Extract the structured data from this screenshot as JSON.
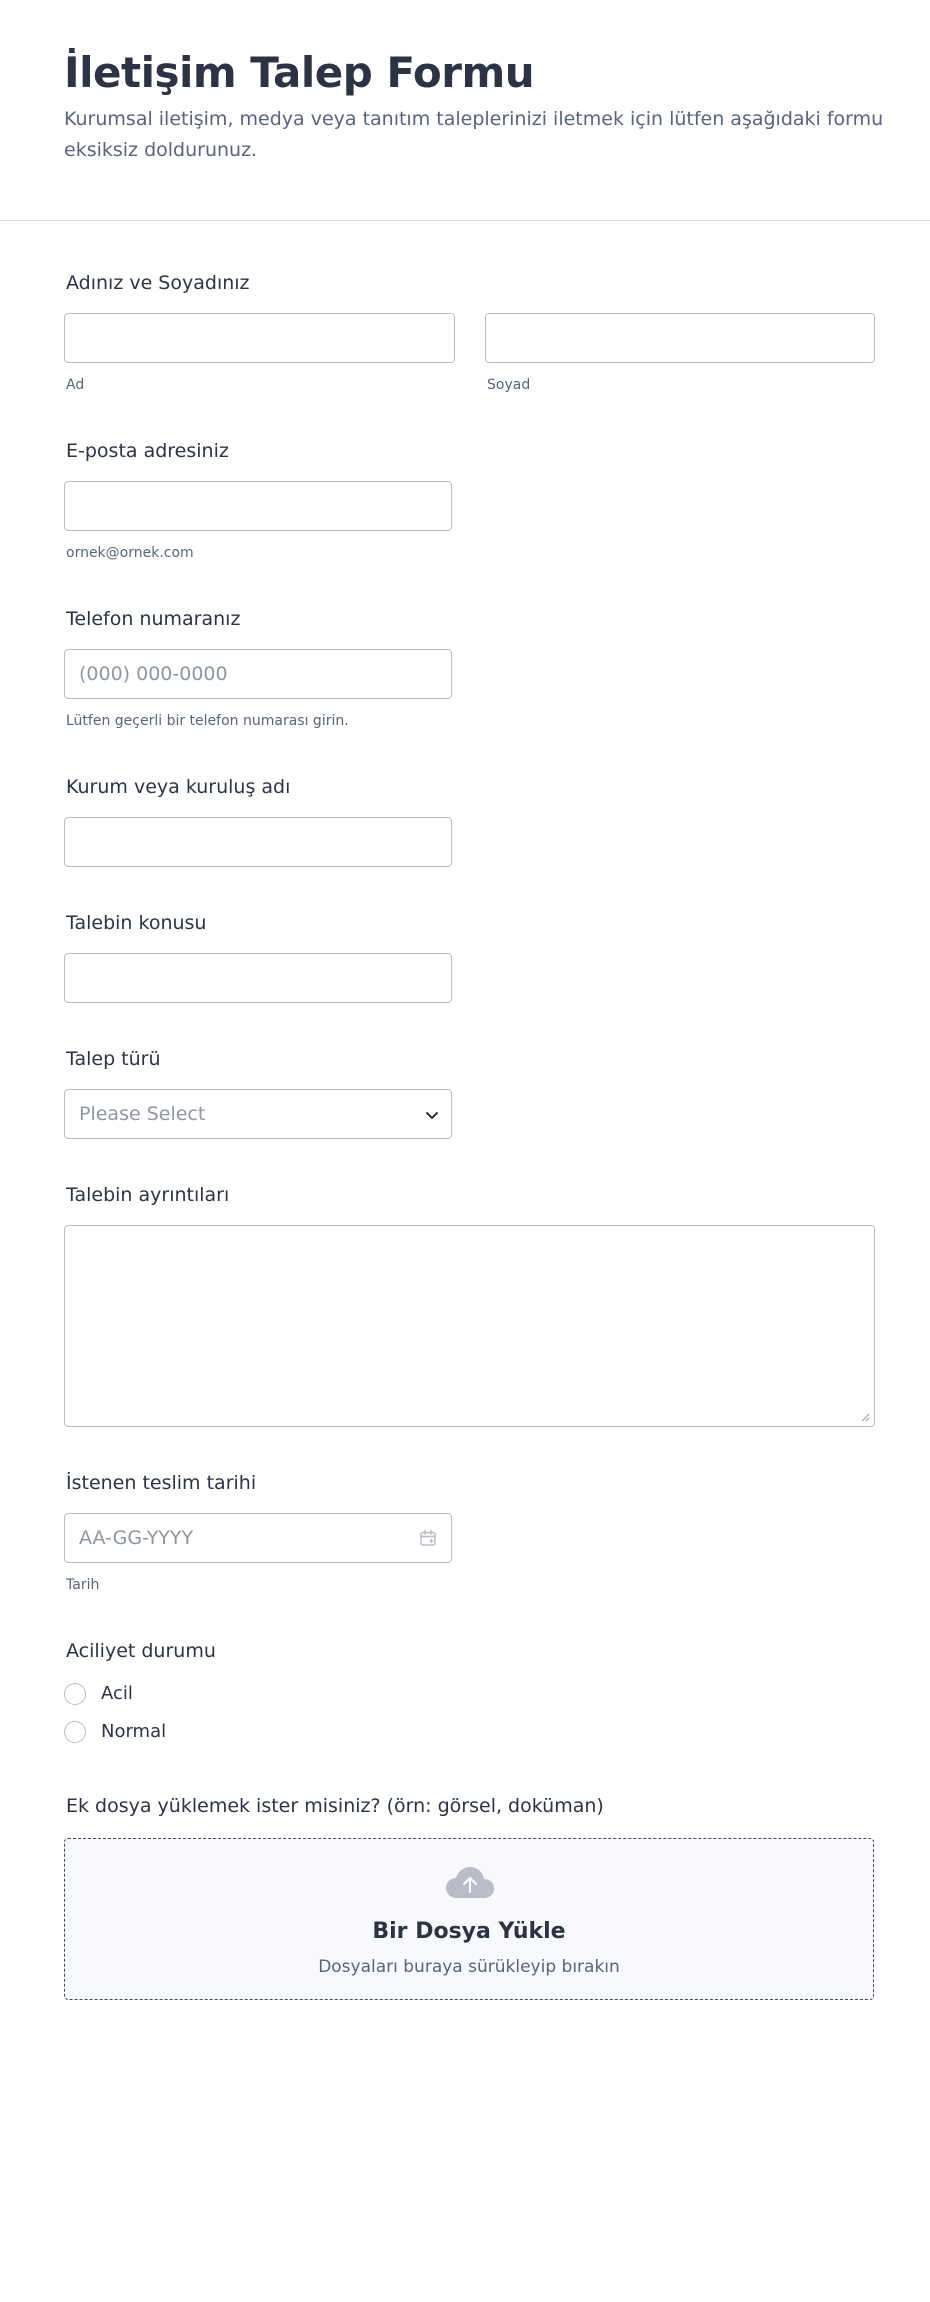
{
  "form": {
    "title": "İletişim Talep Formu",
    "description": "Kurumsal iletişim, medya veya tanıtım taleplerinizi iletmek için lütfen aşağıdaki formu eksiksiz doldurunuz."
  },
  "fields": {
    "name": {
      "label": "Adınız ve Soyadınız",
      "first_sublabel": "Ad",
      "last_sublabel": "Soyad",
      "first_value": "",
      "last_value": ""
    },
    "email": {
      "label": "E-posta adresiniz",
      "sublabel": "ornek@ornek.com",
      "value": ""
    },
    "phone": {
      "label": "Telefon numaranız",
      "placeholder": "(000) 000-0000",
      "sublabel": "Lütfen geçerli bir telefon numarası girin."
    },
    "organization": {
      "label": "Kurum veya kuruluş adı",
      "value": ""
    },
    "subject": {
      "label": "Talebin konusu",
      "value": ""
    },
    "request_type": {
      "label": "Talep türü",
      "selected": "Please Select"
    },
    "details": {
      "label": "Talebin ayrıntıları",
      "value": ""
    },
    "due_date": {
      "label": "İstenen teslim tarihi",
      "placeholder": "AA-GG-YYYY",
      "sublabel": "Tarih"
    },
    "urgency": {
      "label": "Aciliyet durumu",
      "options": [
        "Acil",
        "Normal"
      ]
    },
    "attachment": {
      "label": "Ek dosya yüklemek ister misiniz? (örn: görsel, doküman)",
      "button": "Bir Dosya Yükle",
      "hint": "Dosyaları buraya sürükleyip bırakın"
    }
  },
  "icons": {
    "select": "chevron-down-icon",
    "date": "calendar-icon",
    "upload": "cloud-upload-icon"
  },
  "colors": {
    "text": "#2c3345",
    "muted": "#57647e",
    "border": "#b8bdc9",
    "upload_bg": "#f8f9fc"
  }
}
